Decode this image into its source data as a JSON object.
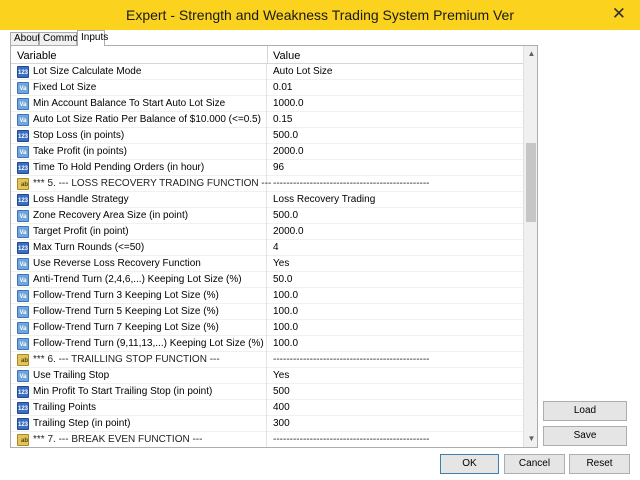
{
  "window": {
    "title": "Expert - Strength and Weakness Trading System Premium Ver",
    "close_glyph": "✕"
  },
  "tabs": [
    {
      "label": "About"
    },
    {
      "label": "Common"
    },
    {
      "label": "Inputs"
    }
  ],
  "grid": {
    "headers": {
      "variable": "Variable",
      "value": "Value"
    },
    "rows": [
      {
        "icon": "123",
        "variable": "Lot Size Calculate Mode",
        "value": "Auto Lot Size"
      },
      {
        "icon": "Va",
        "variable": "Fixed Lot Size",
        "value": "0.01"
      },
      {
        "icon": "Va",
        "variable": "Min Account Balance To Start Auto Lot Size",
        "value": "1000.0"
      },
      {
        "icon": "Va",
        "variable": "Auto Lot Size Ratio Per Balance of $10.000 (<=0.5)",
        "value": "0.15"
      },
      {
        "icon": "123",
        "variable": "Stop Loss (in points)",
        "value": "500.0"
      },
      {
        "icon": "Va",
        "variable": "Take Profit (in points)",
        "value": "2000.0"
      },
      {
        "icon": "123",
        "variable": "Time To Hold Pending Orders (in hour)",
        "value": "96"
      },
      {
        "icon": "ab",
        "variable": "*** 5. --- LOSS RECOVERY TRADING FUNCTION ---",
        "value": "-----------------------------------------------"
      },
      {
        "icon": "123",
        "variable": "Loss Handle Strategy",
        "value": "Loss Recovery Trading"
      },
      {
        "icon": "Va",
        "variable": "Zone Recovery Area Size (in point)",
        "value": "500.0"
      },
      {
        "icon": "Va",
        "variable": "Target Profit (in point)",
        "value": "2000.0"
      },
      {
        "icon": "123",
        "variable": "Max Turn Rounds (<=50)",
        "value": "4"
      },
      {
        "icon": "Va",
        "variable": "Use Reverse Loss Recovery Function",
        "value": "Yes"
      },
      {
        "icon": "Va",
        "variable": "Anti-Trend Turn (2,4,6,...) Keeping Lot Size (%)",
        "value": "50.0"
      },
      {
        "icon": "Va",
        "variable": "Follow-Trend Turn 3 Keeping Lot Size (%)",
        "value": "100.0"
      },
      {
        "icon": "Va",
        "variable": "Follow-Trend Turn 5 Keeping Lot Size (%)",
        "value": "100.0"
      },
      {
        "icon": "Va",
        "variable": "Follow-Trend Turn 7 Keeping Lot Size (%)",
        "value": "100.0"
      },
      {
        "icon": "Va",
        "variable": "Follow-Trend Turn (9,11,13,...) Keeping Lot Size (%)",
        "value": "100.0"
      },
      {
        "icon": "ab",
        "variable": "*** 6. --- TRAILLING STOP FUNCTION ---",
        "value": "-----------------------------------------------"
      },
      {
        "icon": "Va",
        "variable": "Use Trailing Stop",
        "value": "Yes"
      },
      {
        "icon": "123",
        "variable": "Min Profit To Start Trailing Stop (in point)",
        "value": "500"
      },
      {
        "icon": "123",
        "variable": "Trailing Points",
        "value": "400"
      },
      {
        "icon": "123",
        "variable": "Trailing Step (in point)",
        "value": "300"
      },
      {
        "icon": "ab",
        "variable": "*** 7. --- BREAK EVEN FUNCTION ---",
        "value": "-----------------------------------------------"
      }
    ]
  },
  "scrollbar": {
    "up_glyph": "▲",
    "down_glyph": "▼"
  },
  "buttons": {
    "load": "Load",
    "save": "Save",
    "ok": "OK",
    "cancel": "Cancel",
    "reset": "Reset"
  },
  "colors": {
    "titlebar": "#fbd21e"
  }
}
